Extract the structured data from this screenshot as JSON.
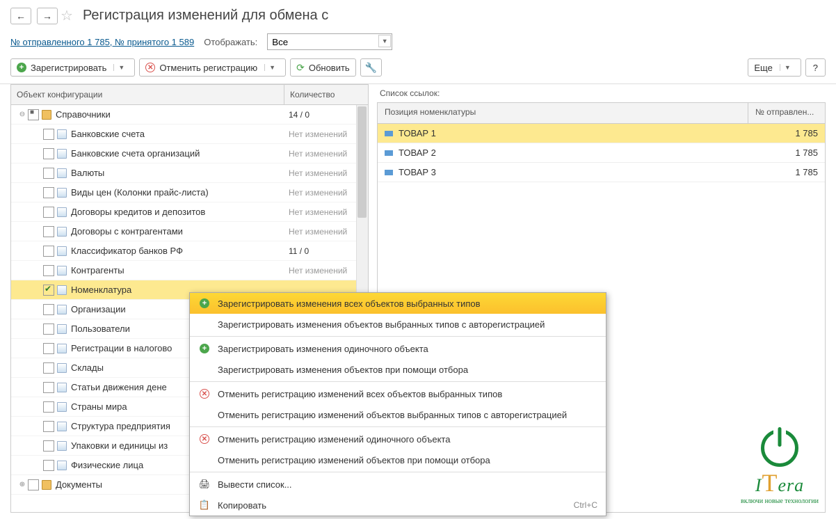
{
  "header": {
    "title": "Регистрация изменений для обмена с"
  },
  "subheader": {
    "link_text": "№ отправленного 1 785, № принятого 1 589",
    "display_label": "Отображать:",
    "display_value": "Все"
  },
  "toolbar": {
    "register": "Зарегистрировать",
    "cancel_reg": "Отменить регистрацию",
    "refresh": "Обновить",
    "more": "Еще",
    "help": "?"
  },
  "left": {
    "col1": "Объект конфигурации",
    "col2": "Количество",
    "root": {
      "label": "Справочники",
      "count": "14 / 0"
    },
    "items": [
      {
        "label": "Банковские счета",
        "count": "Нет изменений"
      },
      {
        "label": "Банковские счета организаций",
        "count": "Нет изменений"
      },
      {
        "label": "Валюты",
        "count": "Нет изменений"
      },
      {
        "label": "Виды цен (Колонки прайс-листа)",
        "count": "Нет изменений"
      },
      {
        "label": "Договоры кредитов и депозитов",
        "count": "Нет изменений"
      },
      {
        "label": "Договоры с контрагентами",
        "count": "Нет изменений"
      },
      {
        "label": "Классификатор банков РФ",
        "count": "11 / 0"
      },
      {
        "label": "Контрагенты",
        "count": "Нет изменений"
      },
      {
        "label": "Номенклатура",
        "count": "",
        "selected": true,
        "checked": true
      },
      {
        "label": "Организации",
        "count": ""
      },
      {
        "label": "Пользователи",
        "count": ""
      },
      {
        "label": "Регистрации в налогово",
        "count": ""
      },
      {
        "label": "Склады",
        "count": ""
      },
      {
        "label": "Статьи движения дене",
        "count": ""
      },
      {
        "label": "Страны мира",
        "count": ""
      },
      {
        "label": "Структура предприятия",
        "count": ""
      },
      {
        "label": "Упаковки и единицы из",
        "count": ""
      },
      {
        "label": "Физические лица",
        "count": ""
      }
    ],
    "root2": {
      "label": "Документы"
    }
  },
  "right": {
    "label": "Список ссылок:",
    "col1": "Позиция номенклатуры",
    "col2": "№ отправлен...",
    "rows": [
      {
        "name": "ТОВАР 1",
        "num": "1 785",
        "selected": true
      },
      {
        "name": "ТОВАР 2",
        "num": "1 785"
      },
      {
        "name": "ТОВАР 3",
        "num": "1 785"
      }
    ]
  },
  "menu": {
    "items": [
      {
        "icon": "plus",
        "text": "Зарегистрировать изменения всех объектов выбранных типов",
        "hl": true
      },
      {
        "icon": "",
        "text": "Зарегистрировать изменения объектов выбранных типов с авторегистрацией"
      },
      {
        "sep": true
      },
      {
        "icon": "plus",
        "text": "Зарегистрировать изменения одиночного объекта"
      },
      {
        "icon": "",
        "text": "Зарегистрировать изменения объектов при помощи отбора"
      },
      {
        "sep": true
      },
      {
        "icon": "x",
        "text": "Отменить регистрацию изменений всех объектов выбранных типов"
      },
      {
        "icon": "",
        "text": "Отменить регистрацию изменений объектов выбранных типов с авторегистрацией"
      },
      {
        "sep": true
      },
      {
        "icon": "x",
        "text": "Отменить регистрацию изменений одиночного объекта"
      },
      {
        "icon": "",
        "text": "Отменить регистрацию изменений объектов при помощи отбора"
      },
      {
        "sep": true
      },
      {
        "icon": "print",
        "text": "Вывести список..."
      },
      {
        "icon": "copy",
        "text": "Копировать",
        "shortcut": "Ctrl+C"
      }
    ]
  },
  "logo": {
    "brand": "IТera",
    "sub": "включи новые технологии"
  }
}
